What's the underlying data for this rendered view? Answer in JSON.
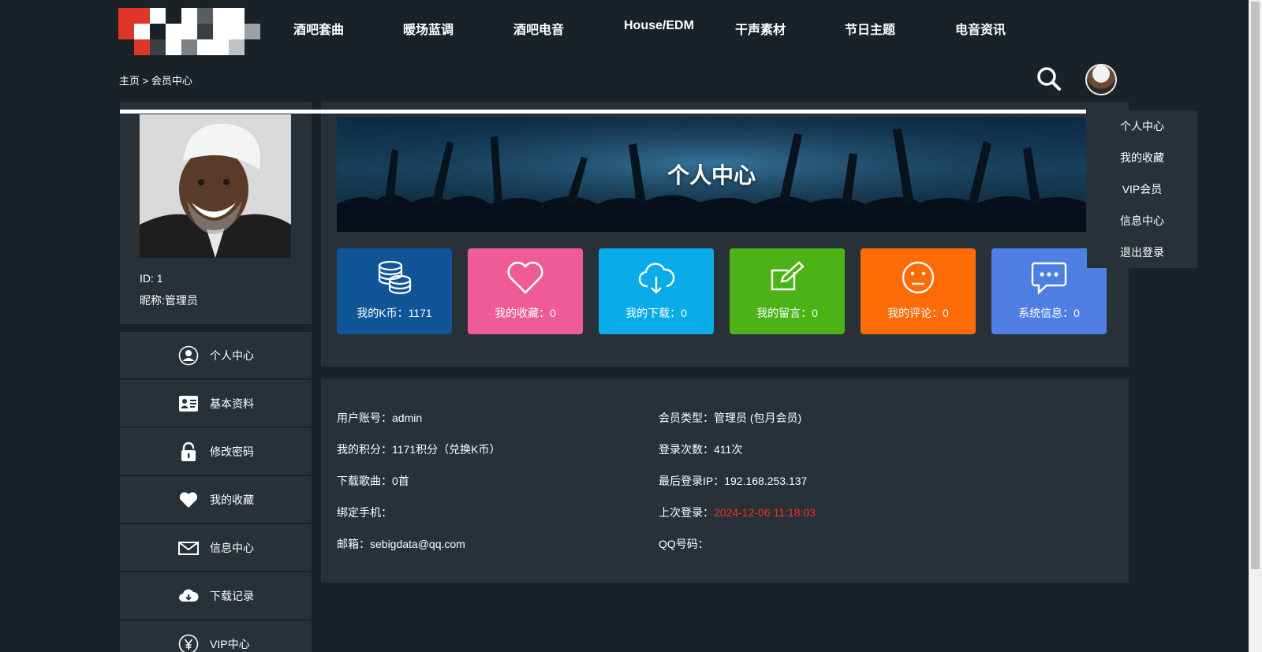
{
  "header": {
    "nav": [
      "酒吧套曲",
      "暖场蓝调",
      "酒吧电音",
      "House/EDM",
      "干声素材",
      "节日主题",
      "电音资讯"
    ]
  },
  "breadcrumb": {
    "home": "主页",
    "separator": ">",
    "current": "会员中心"
  },
  "profile": {
    "id_label": "ID: 1",
    "nickname_label": "昵称:管理员"
  },
  "sidebar": {
    "items": [
      {
        "label": "个人中心",
        "icon": "user-circle-icon"
      },
      {
        "label": "基本资料",
        "icon": "id-card-icon"
      },
      {
        "label": "修改密码",
        "icon": "lock-icon"
      },
      {
        "label": "我的收藏",
        "icon": "heart-icon"
      },
      {
        "label": "信息中心",
        "icon": "mail-icon"
      },
      {
        "label": "下载记录",
        "icon": "cloud-download-icon"
      },
      {
        "label": "VIP中心",
        "icon": "yen-icon"
      }
    ]
  },
  "banner": {
    "title": "个人中心"
  },
  "stats": [
    {
      "label": "我的K币：1171",
      "color": "#0f5597",
      "icon": "coins-icon"
    },
    {
      "label": "我的收藏：0",
      "color": "#ef5b95",
      "icon": "heart-outline-icon"
    },
    {
      "label": "我的下载：0",
      "color": "#0aabe9",
      "icon": "cloud-download-icon"
    },
    {
      "label": "我的留言：0",
      "color": "#4bb316",
      "icon": "edit-icon"
    },
    {
      "label": "我的评论：0",
      "color": "#fd6c07",
      "icon": "smiley-icon"
    },
    {
      "label": "系统信息：0",
      "color": "#4f7fe3",
      "icon": "chat-icon"
    }
  ],
  "info": {
    "left": [
      "用户账号：admin",
      "我的积分：1171积分（兑换K币）",
      "下载歌曲：0首",
      "绑定手机：",
      "邮箱：sebigdata@qq.com"
    ],
    "right": {
      "member_type": "会员类型：管理员 (包月会员)",
      "login_count": "登录次数：411次",
      "last_ip": "最后登录IP：192.168.253.137",
      "last_login_label": "上次登录：",
      "last_login_value": "2024-12-06 11:18:03",
      "qq": "QQ号码："
    }
  },
  "dropdown": [
    "个人中心",
    "我的收藏",
    "VIP会员",
    "信息中心",
    "退出登录"
  ],
  "colors": {
    "background": "#1b2227",
    "panel": "#283137",
    "accent_red": "#ff2b2b"
  }
}
